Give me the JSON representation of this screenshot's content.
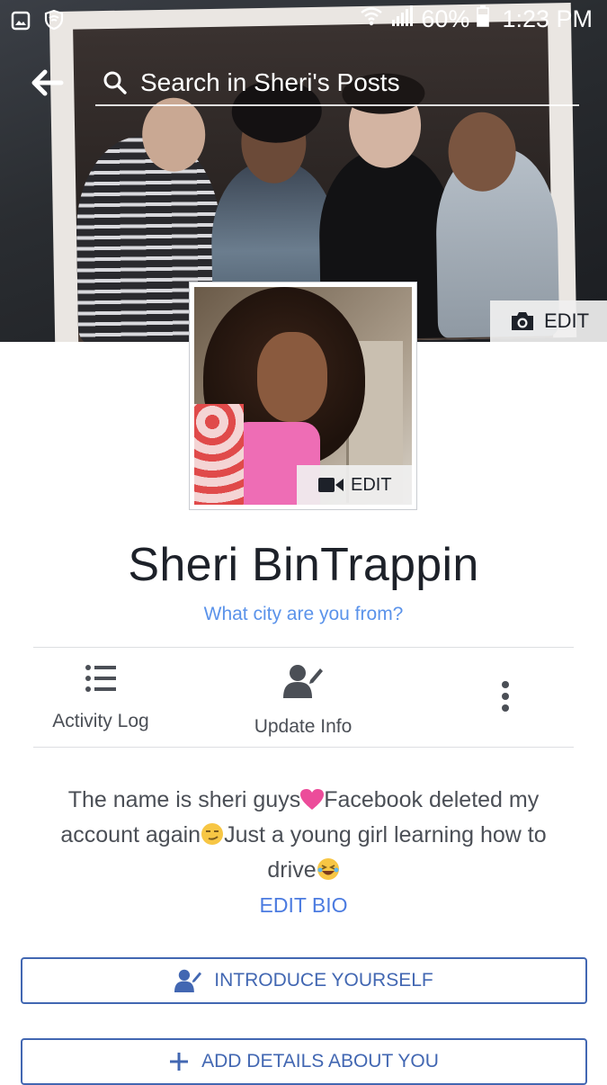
{
  "status_bar": {
    "battery": "60%",
    "time": "1:23 PM"
  },
  "header": {
    "search_placeholder": "Search in Sheri's Posts"
  },
  "cover": {
    "edit_label": "EDIT"
  },
  "profile_photo": {
    "edit_label": "EDIT"
  },
  "profile": {
    "name": "Sheri BinTrappin",
    "city_prompt": "What city are you from?"
  },
  "actions": [
    {
      "label": "Activity Log",
      "icon": "list-icon"
    },
    {
      "label": "Update Info",
      "icon": "user-edit-icon"
    },
    {
      "label": "",
      "icon": "more-vertical-icon"
    }
  ],
  "bio": {
    "part1": "The name is sheri guys",
    "part2": "Facebook deleted my account again",
    "part3": "Just a young girl learning how to drive",
    "emoji": [
      "pink-heart-emoji",
      "smirk-emoji",
      "laughing-emoji"
    ],
    "edit_label": "EDIT BIO"
  },
  "buttons": {
    "introduce": "INTRODUCE YOURSELF",
    "add_details": "ADD DETAILS ABOUT YOU"
  },
  "colors": {
    "accent": "#4267b2",
    "link": "#5b93ea",
    "text": "#1d2129"
  }
}
